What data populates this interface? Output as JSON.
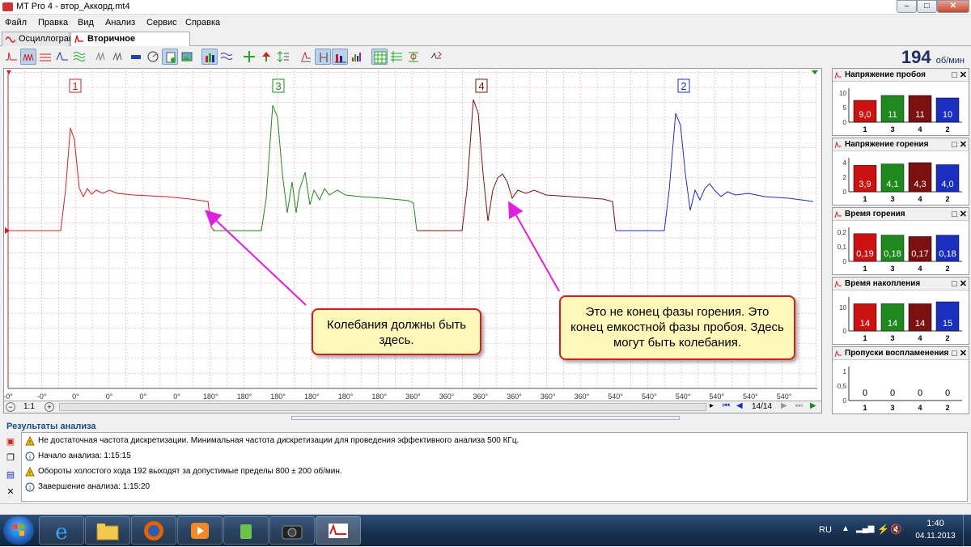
{
  "window": {
    "title": "MT Pro 4 - втор_Аккорд.mt4"
  },
  "menu": [
    "Файл",
    "Правка",
    "Вид",
    "Анализ",
    "Сервис",
    "Справка"
  ],
  "tabs": [
    {
      "label": "Осциллограф",
      "active": false
    },
    {
      "label": "Вторичное напряжение",
      "active": true
    }
  ],
  "rpm": {
    "value": "194",
    "unit": "об/мин"
  },
  "oscillogram": {
    "cylinder_labels": [
      {
        "label": "1",
        "color": "#cc2222"
      },
      {
        "label": "3",
        "color": "#1e8a1e"
      },
      {
        "label": "4",
        "color": "#7a1010"
      },
      {
        "label": "2",
        "color": "#1a2fc0"
      }
    ],
    "x_ticks": [
      "-0°",
      "-0°",
      "0°",
      "0°",
      "0°",
      "0°",
      "180°",
      "180°",
      "180°",
      "180°",
      "180°",
      "180°",
      "360°",
      "360°",
      "360°",
      "360°",
      "360°",
      "360°",
      "540°",
      "540°",
      "540°",
      "540°",
      "540°",
      "540°"
    ],
    "scale": "1:1",
    "page": "14/14"
  },
  "callouts": {
    "left": "Колебания должны быть здесь.",
    "right": "Это не конец фазы горения. Это конец емкостной фазы пробоя. Здесь могут быть колебания."
  },
  "panels": [
    {
      "title": "Напряжение пробоя",
      "yticks": [
        "10",
        "5",
        "0"
      ],
      "ymax": 12,
      "bars": [
        {
          "cyl": "1",
          "value": 9.0,
          "label": "9,0",
          "color": "#cc1111"
        },
        {
          "cyl": "3",
          "value": 11,
          "label": "11",
          "color": "#1e8a1e"
        },
        {
          "cyl": "4",
          "value": 11,
          "label": "11",
          "color": "#7a1010"
        },
        {
          "cyl": "2",
          "value": 10,
          "label": "10",
          "color": "#1a2fc0"
        }
      ]
    },
    {
      "title": "Напряжение горения",
      "yticks": [
        "4",
        "2",
        "0"
      ],
      "ymax": 4.3,
      "bars": [
        {
          "cyl": "1",
          "value": 3.9,
          "label": "3,9",
          "color": "#cc1111"
        },
        {
          "cyl": "3",
          "value": 4.1,
          "label": "4,1",
          "color": "#1e8a1e"
        },
        {
          "cyl": "4",
          "value": 4.3,
          "label": "4,3",
          "color": "#7a1010"
        },
        {
          "cyl": "2",
          "value": 4.0,
          "label": "4,0",
          "color": "#1a2fc0"
        }
      ]
    },
    {
      "title": "Время горения",
      "yticks": [
        "0,2",
        "0,1",
        "0"
      ],
      "ymax": 0.2,
      "bars": [
        {
          "cyl": "1",
          "value": 0.19,
          "label": "0,19",
          "color": "#cc1111"
        },
        {
          "cyl": "3",
          "value": 0.18,
          "label": "0,18",
          "color": "#1e8a1e"
        },
        {
          "cyl": "4",
          "value": 0.17,
          "label": "0,17",
          "color": "#7a1010"
        },
        {
          "cyl": "2",
          "value": 0.18,
          "label": "0,18",
          "color": "#1a2fc0"
        }
      ]
    },
    {
      "title": "Время накопления",
      "yticks": [
        "10",
        "0"
      ],
      "ymax": 15,
      "bars": [
        {
          "cyl": "1",
          "value": 14,
          "label": "14",
          "color": "#cc1111"
        },
        {
          "cyl": "3",
          "value": 14,
          "label": "14",
          "color": "#1e8a1e"
        },
        {
          "cyl": "4",
          "value": 14,
          "label": "14",
          "color": "#7a1010"
        },
        {
          "cyl": "2",
          "value": 15,
          "label": "15",
          "color": "#1a2fc0"
        }
      ]
    },
    {
      "title": "Пропуски воспламенения",
      "yticks": [
        "1",
        "0,5",
        "0"
      ],
      "ymax": 1,
      "bars": [
        {
          "cyl": "1",
          "value": 0,
          "label": "0",
          "color": "#cc1111"
        },
        {
          "cyl": "3",
          "value": 0,
          "label": "0",
          "color": "#1e8a1e"
        },
        {
          "cyl": "4",
          "value": 0,
          "label": "0",
          "color": "#7a1010"
        },
        {
          "cyl": "2",
          "value": 0,
          "label": "0",
          "color": "#1a2fc0"
        }
      ]
    }
  ],
  "results": {
    "title": "Результаты анализа",
    "rows": [
      {
        "icon": "warning-icon",
        "text": "Не достаточная частота дискретизации. Минимальная частота дискретизации для проведения эффективного анализа 500 КГц."
      },
      {
        "icon": "info-icon",
        "text": "Начало анализа: 1:15:15"
      },
      {
        "icon": "warning-icon",
        "text": "Обороты холостого хода 192 выходят за допустимые пределы 800 ± 200 об/мин."
      },
      {
        "icon": "info-icon",
        "text": "Завершение анализа: 1:15:20"
      }
    ]
  },
  "taskbar": {
    "lang": "RU",
    "time": "1:40",
    "date": "04.11.2013"
  }
}
